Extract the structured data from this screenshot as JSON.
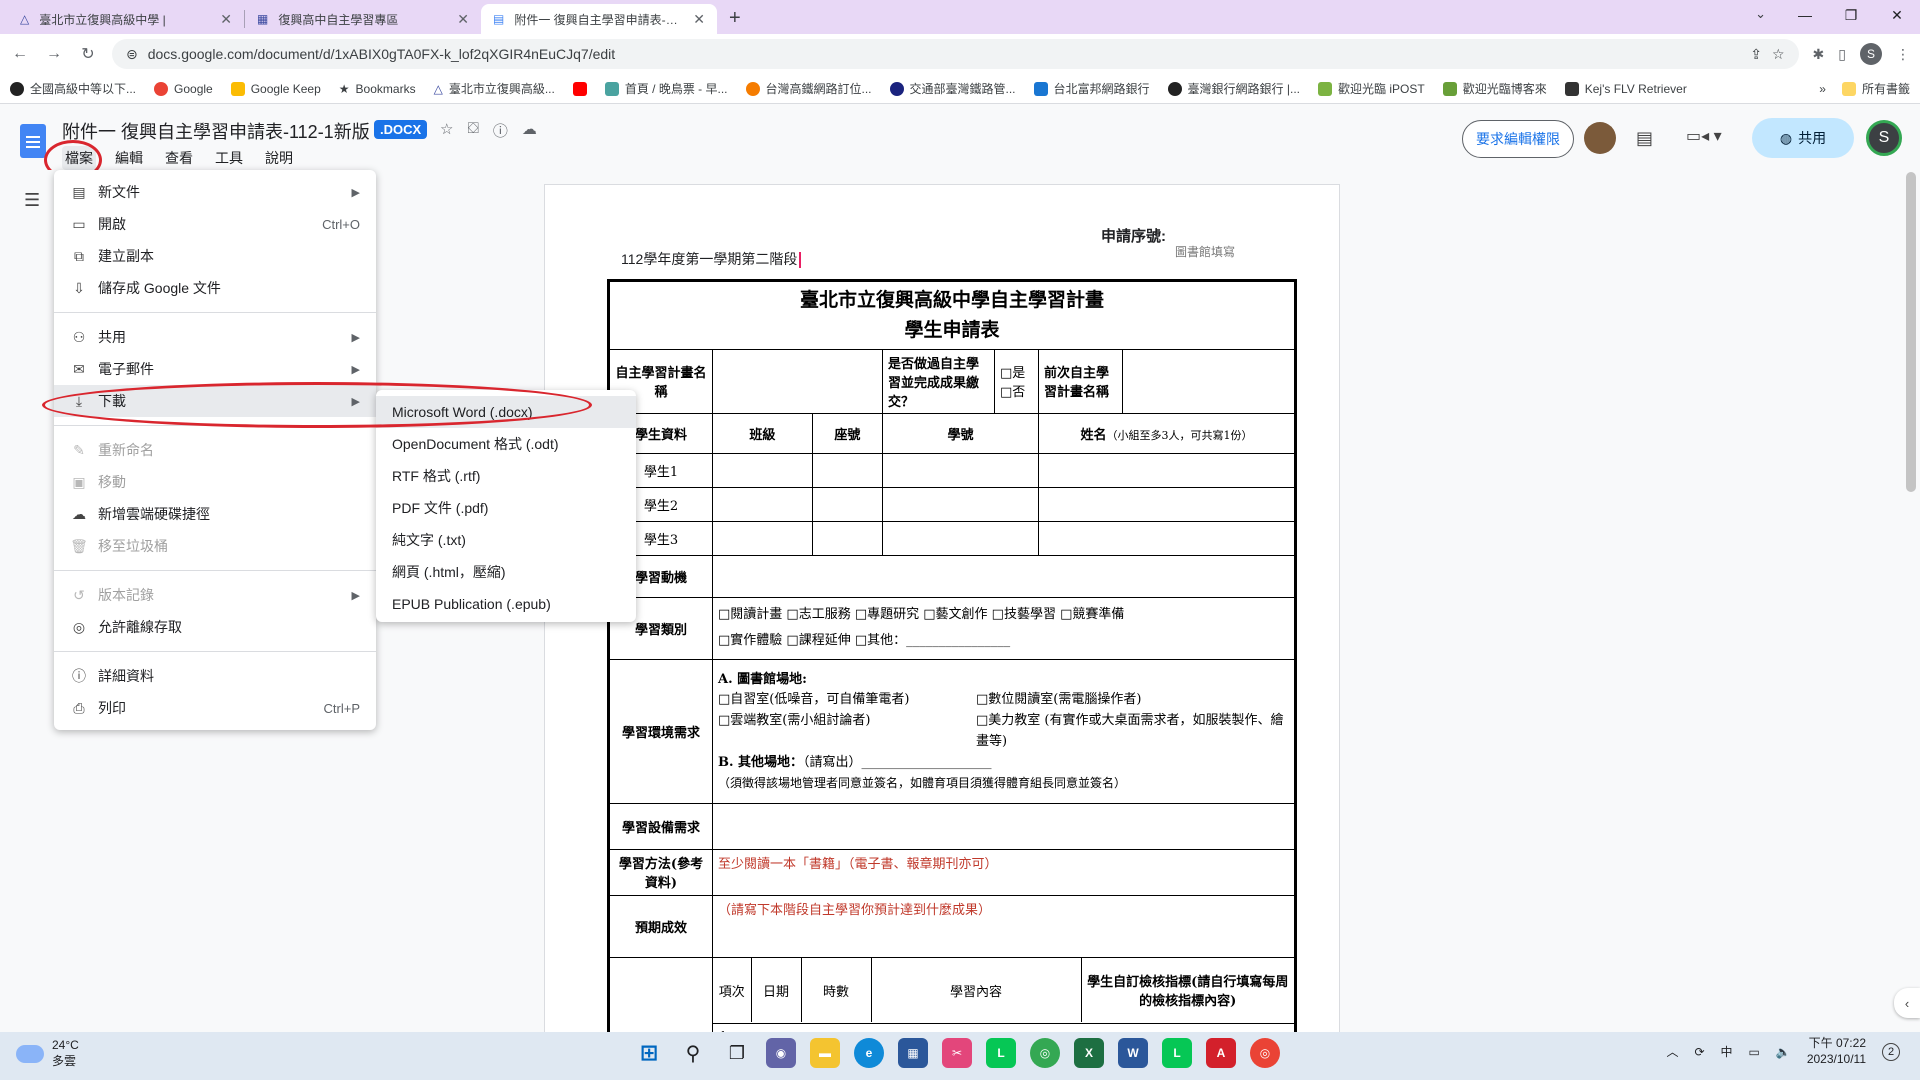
{
  "browser": {
    "tabs": [
      {
        "title": "臺北市立復興高級中學 |",
        "active": false
      },
      {
        "title": "復興高中自主學習專區",
        "active": false
      },
      {
        "title": "附件一 復興自主學習申請表-112",
        "active": true
      }
    ],
    "url": "docs.google.com/document/d/1xABIX0gTA0FX-k_lof2qXGIR4nEuCJq7/edit",
    "profile_initial": "S",
    "bookmarks": [
      "全國高級中等以下...",
      "Google",
      "Google Keep",
      "Bookmarks",
      "臺北市立復興高級...",
      "首頁 / 晚鳥票 - 早...",
      "台灣高鐵網路訂位...",
      "交通部臺灣鐵路管...",
      "台北富邦網路銀行",
      "臺灣銀行網路銀行 |...",
      "歡迎光臨 iPOST",
      "歡迎光臨博客來",
      "Kej's FLV Retriever"
    ],
    "bookmarks_more": "»",
    "all_bookmarks": "所有書籤"
  },
  "docs": {
    "title": "附件一 復興自主學習申請表-112-1新版",
    "badge": ".DOCX",
    "menus": [
      "檔案",
      "編輯",
      "查看",
      "工具",
      "說明"
    ],
    "request_edit": "要求編輯權限",
    "share": "共用",
    "avatar_initial": "S"
  },
  "file_menu": {
    "items": [
      {
        "icon": "▤",
        "label": "新文件",
        "shortcut": "",
        "submenu": true,
        "disabled": false
      },
      {
        "icon": "▭",
        "label": "開啟",
        "shortcut": "Ctrl+O",
        "submenu": false,
        "disabled": false
      },
      {
        "icon": "⧉",
        "label": "建立副本",
        "shortcut": "",
        "submenu": false,
        "disabled": false
      },
      {
        "icon": "⇩",
        "label": "儲存成 Google 文件",
        "shortcut": "",
        "submenu": false,
        "disabled": false
      },
      {
        "icon": "⚇",
        "label": "共用",
        "shortcut": "",
        "submenu": true,
        "disabled": false
      },
      {
        "icon": "✉",
        "label": "電子郵件",
        "shortcut": "",
        "submenu": true,
        "disabled": false
      },
      {
        "icon": "⤓",
        "label": "下載",
        "shortcut": "",
        "submenu": true,
        "disabled": false
      },
      {
        "icon": "✎",
        "label": "重新命名",
        "shortcut": "",
        "submenu": false,
        "disabled": true
      },
      {
        "icon": "▣",
        "label": "移動",
        "shortcut": "",
        "submenu": false,
        "disabled": true
      },
      {
        "icon": "☁",
        "label": "新增雲端硬碟捷徑",
        "shortcut": "",
        "submenu": false,
        "disabled": false
      },
      {
        "icon": "🗑",
        "label": "移至垃圾桶",
        "shortcut": "",
        "submenu": false,
        "disabled": true
      },
      {
        "icon": "↺",
        "label": "版本記錄",
        "shortcut": "",
        "submenu": true,
        "disabled": true
      },
      {
        "icon": "◎",
        "label": "允許離線存取",
        "shortcut": "",
        "submenu": false,
        "disabled": false
      },
      {
        "icon": "ⓘ",
        "label": "詳細資料",
        "shortcut": "",
        "submenu": false,
        "disabled": false
      },
      {
        "icon": "⎙",
        "label": "列印",
        "shortcut": "Ctrl+P",
        "submenu": false,
        "disabled": false
      }
    ]
  },
  "download_menu": {
    "items": [
      "Microsoft Word (.docx)",
      "OpenDocument 格式 (.odt)",
      "RTF 格式 (.rtf)",
      "PDF 文件 (.pdf)",
      "純文字 (.txt)",
      "網頁 (.html，壓縮)",
      "EPUB Publication (.epub)"
    ]
  },
  "page": {
    "application_no": "申請序號:",
    "library_fill": "圖書館填寫",
    "term": "112學年度第一學期第二階段",
    "form": {
      "title1": "臺北市立復興高級中學自主學習計畫",
      "title2": "學生申請表",
      "plan_name": "自主學習計畫名稱",
      "done_before": "是否做過自主學習並完成成果繳交？",
      "yes": "□是",
      "no": "□否",
      "prev_plan": "前次自主學習計畫名稱",
      "student_info": "學生資料",
      "class": "班級",
      "seat": "座號",
      "student_id": "學號",
      "name": "姓名",
      "name_note": "（小組至多3人，可共寫1份）",
      "students": [
        "學生1",
        "學生2",
        "學生3"
      ],
      "motivation": "學習動機",
      "category": "學習類別",
      "category_line1": "□閱讀計畫 □志工服務 □專題研究 □藝文創作 □技藝學習 □競賽準備",
      "category_line2": "□實作體驗 □課程延伸 □其他：________________",
      "env": "學習環境需求",
      "env_a": "A. 圖書館場地:",
      "env_a1": "□自習室(低噪音，可自備筆電者)",
      "env_a2": "□數位閱讀室(需電腦操作者)",
      "env_a3": "□雲端教室(需小組討論者)",
      "env_a4": "□美力教室 (有實作或大桌面需求者，如服裝製作、繪畫等)",
      "env_b": "B. 其他場地：",
      "env_b_hint": "（請寫出）____________________",
      "env_note": "（須徵得該場地管理者同意並簽名，如體育項目須獲得體育組長同意並簽名）",
      "equipment": "學習設備需求",
      "method": "學習方法(參考資料)",
      "method_text": "至少閱讀一本「書籍」（電子書、報章期刊亦可）",
      "outcome": "預期成效",
      "outcome_text": "（請寫下本階段自主學習你預計達到什麼成果）",
      "col_item": "項次",
      "col_date": "日期",
      "col_hours": "時數",
      "col_content": "學習內容",
      "col_indicator": "學生自訂檢核指標(請自行填寫每周的檢核指標內容)",
      "row1": "1"
    }
  },
  "taskbar": {
    "temp": "24°C",
    "weather": "多雲",
    "time": "下午 07:22",
    "date": "2023/10/11",
    "ime": "中",
    "notifications": "2"
  }
}
